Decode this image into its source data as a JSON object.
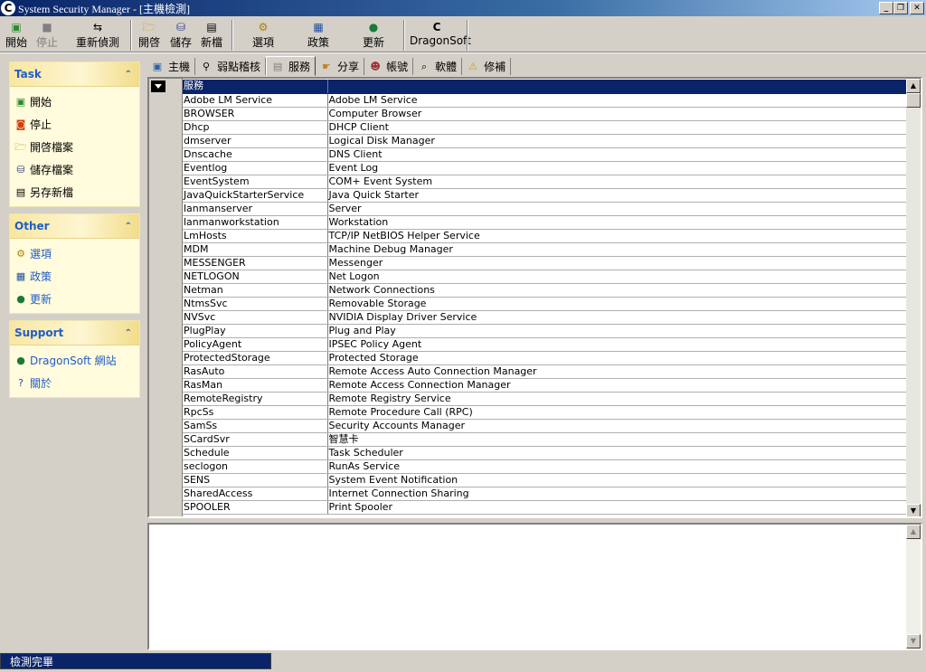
{
  "window": {
    "title": "System Security Manager - [主機檢測]",
    "buttons": [
      "_",
      "❐",
      "✕"
    ]
  },
  "toolbar": {
    "start": "開始",
    "stop": "停止",
    "rescan": "重新偵測",
    "open": "開啓",
    "save": "儲存",
    "new": "新檔",
    "options": "選項",
    "policy": "政策",
    "update": "更新",
    "dragonsoft": "DragonSoft"
  },
  "sidebar": {
    "task": {
      "title": "Task",
      "items": [
        "開始",
        "停止",
        "開啓檔案",
        "儲存檔案",
        "另存新檔"
      ]
    },
    "other": {
      "title": "Other",
      "items": [
        "選項",
        "政策",
        "更新"
      ]
    },
    "support": {
      "title": "Support",
      "items": [
        "DragonSoft 網站",
        "關於"
      ]
    }
  },
  "tabs": [
    "主機",
    "弱點稽核",
    "服務",
    "分享",
    "帳號",
    "軟體",
    "修補"
  ],
  "active_tab": "服務",
  "services": {
    "header": [
      "服務",
      ""
    ],
    "rows": [
      [
        "Adobe LM Service",
        "Adobe LM Service"
      ],
      [
        "BROWSER",
        "Computer Browser"
      ],
      [
        "Dhcp",
        "DHCP Client"
      ],
      [
        "dmserver",
        "Logical Disk Manager"
      ],
      [
        "Dnscache",
        "DNS Client"
      ],
      [
        "Eventlog",
        "Event Log"
      ],
      [
        "EventSystem",
        "COM+ Event System"
      ],
      [
        "JavaQuickStarterService",
        "Java Quick Starter"
      ],
      [
        "lanmanserver",
        "Server"
      ],
      [
        "lanmanworkstation",
        "Workstation"
      ],
      [
        "LmHosts",
        "TCP/IP NetBIOS Helper Service"
      ],
      [
        "MDM",
        "Machine Debug Manager"
      ],
      [
        "MESSENGER",
        "Messenger"
      ],
      [
        "NETLOGON",
        "Net Logon"
      ],
      [
        "Netman",
        "Network Connections"
      ],
      [
        "NtmsSvc",
        "Removable Storage"
      ],
      [
        "NVSvc",
        "NVIDIA Display Driver Service"
      ],
      [
        "PlugPlay",
        "Plug and Play"
      ],
      [
        "PolicyAgent",
        "IPSEC Policy Agent"
      ],
      [
        "ProtectedStorage",
        "Protected Storage"
      ],
      [
        "RasAuto",
        "Remote Access Auto Connection Manager"
      ],
      [
        "RasMan",
        "Remote Access Connection Manager"
      ],
      [
        "RemoteRegistry",
        "Remote Registry Service"
      ],
      [
        "RpcSs",
        "Remote Procedure Call (RPC)"
      ],
      [
        "SamSs",
        "Security Accounts Manager"
      ],
      [
        "SCardSvr",
        "智慧卡"
      ],
      [
        "Schedule",
        "Task Scheduler"
      ],
      [
        "seclogon",
        "RunAs Service"
      ],
      [
        "SENS",
        "System Event Notification"
      ],
      [
        "SharedAccess",
        "Internet Connection Sharing"
      ],
      [
        "SPOOLER",
        "Print Spooler"
      ]
    ]
  },
  "status": {
    "text": "檢測完畢"
  },
  "colors": {
    "titlebar": "#0a246a",
    "selection": "#0a246a",
    "sidebar_bg": "#fffbdc",
    "sidebar_title": "#215dc6",
    "chrome": "#d4d0c8"
  }
}
